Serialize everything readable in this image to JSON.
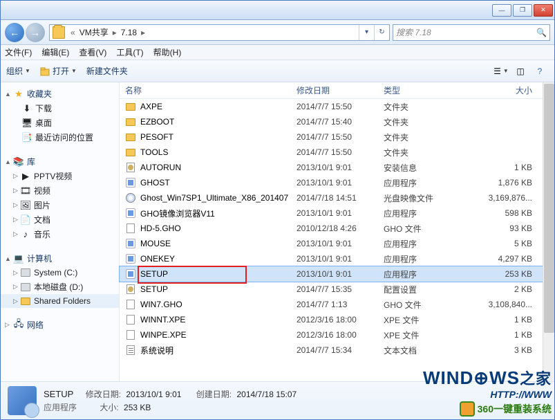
{
  "titlebar": {
    "min": "—",
    "max": "❐",
    "close": "✕"
  },
  "nav": {
    "crumbs": [
      "VM共享",
      "7.18"
    ],
    "sep": "▸",
    "dropdown": "▾",
    "refresh": "↻",
    "search_placeholder": "搜索 7.18"
  },
  "menubar": [
    "文件(F)",
    "编辑(E)",
    "查看(V)",
    "工具(T)",
    "帮助(H)"
  ],
  "toolbar": {
    "organize": "组织",
    "open": "打开",
    "newfolder": "新建文件夹"
  },
  "sidebar": {
    "fav": {
      "head": "收藏夹",
      "items": [
        "下载",
        "桌面",
        "最近访问的位置"
      ]
    },
    "lib": {
      "head": "库",
      "items": [
        "PPTV视频",
        "视频",
        "图片",
        "文档",
        "音乐"
      ]
    },
    "pc": {
      "head": "计算机",
      "items": [
        "System (C:)",
        "本地磁盘 (D:)",
        "Shared Folders"
      ]
    },
    "net": {
      "head": "网络"
    }
  },
  "columns": {
    "name": "名称",
    "date": "修改日期",
    "type": "类型",
    "size": "大小"
  },
  "files": [
    {
      "ic": "folder",
      "n": "AXPE",
      "d": "2014/7/7 15:50",
      "t": "文件夹",
      "s": ""
    },
    {
      "ic": "folder",
      "n": "EZBOOT",
      "d": "2014/7/7 15:40",
      "t": "文件夹",
      "s": ""
    },
    {
      "ic": "folder",
      "n": "PESOFT",
      "d": "2014/7/7 15:50",
      "t": "文件夹",
      "s": ""
    },
    {
      "ic": "folder",
      "n": "TOOLS",
      "d": "2014/7/7 15:50",
      "t": "文件夹",
      "s": ""
    },
    {
      "ic": "ini",
      "n": "AUTORUN",
      "d": "2013/10/1 9:01",
      "t": "安装信息",
      "s": "1 KB"
    },
    {
      "ic": "exe",
      "n": "GHOST",
      "d": "2013/10/1 9:01",
      "t": "应用程序",
      "s": "1,876 KB"
    },
    {
      "ic": "iso",
      "n": "Ghost_Win7SP1_Ultimate_X86_201407",
      "d": "2014/7/18 14:51",
      "t": "光盘映像文件",
      "s": "3,169,876..."
    },
    {
      "ic": "exe",
      "n": "GHO镜像浏览器V11",
      "d": "2013/10/1 9:01",
      "t": "应用程序",
      "s": "598 KB"
    },
    {
      "ic": "gho",
      "n": "HD-5.GHO",
      "d": "2010/12/18 4:26",
      "t": "GHO 文件",
      "s": "93 KB"
    },
    {
      "ic": "exe",
      "n": "MOUSE",
      "d": "2013/10/1 9:01",
      "t": "应用程序",
      "s": "5 KB"
    },
    {
      "ic": "exe",
      "n": "ONEKEY",
      "d": "2013/10/1 9:01",
      "t": "应用程序",
      "s": "4,297 KB"
    },
    {
      "ic": "exe",
      "n": "SETUP",
      "d": "2013/10/1 9:01",
      "t": "应用程序",
      "s": "253 KB",
      "sel": true
    },
    {
      "ic": "ini",
      "n": "SETUP",
      "d": "2014/7/7 15:35",
      "t": "配置设置",
      "s": "2 KB"
    },
    {
      "ic": "gho",
      "n": "WIN7.GHO",
      "d": "2014/7/7 1:13",
      "t": "GHO 文件",
      "s": "3,108,840..."
    },
    {
      "ic": "xpe",
      "n": "WINNT.XPE",
      "d": "2012/3/16 18:00",
      "t": "XPE 文件",
      "s": "1 KB"
    },
    {
      "ic": "xpe",
      "n": "WINPE.XPE",
      "d": "2012/3/16 18:00",
      "t": "XPE 文件",
      "s": "1 KB"
    },
    {
      "ic": "txt",
      "n": "系统说明",
      "d": "2014/7/7 15:34",
      "t": "文本文档",
      "s": "3 KB"
    }
  ],
  "details": {
    "name": "SETUP",
    "l_mod": "修改日期:",
    "v_mod": "2013/10/1 9:01",
    "l_crt": "创建日期:",
    "v_crt": "2014/7/18 15:07",
    "l_typ": "应用程序",
    "l_siz": "大小:",
    "v_siz": "253 KB"
  },
  "watermark": {
    "line1a": "WIND",
    "line1b": "WS",
    "line1c": "之家",
    "line2": "HTTP://WWW",
    "line3": "360一键重装系统"
  }
}
